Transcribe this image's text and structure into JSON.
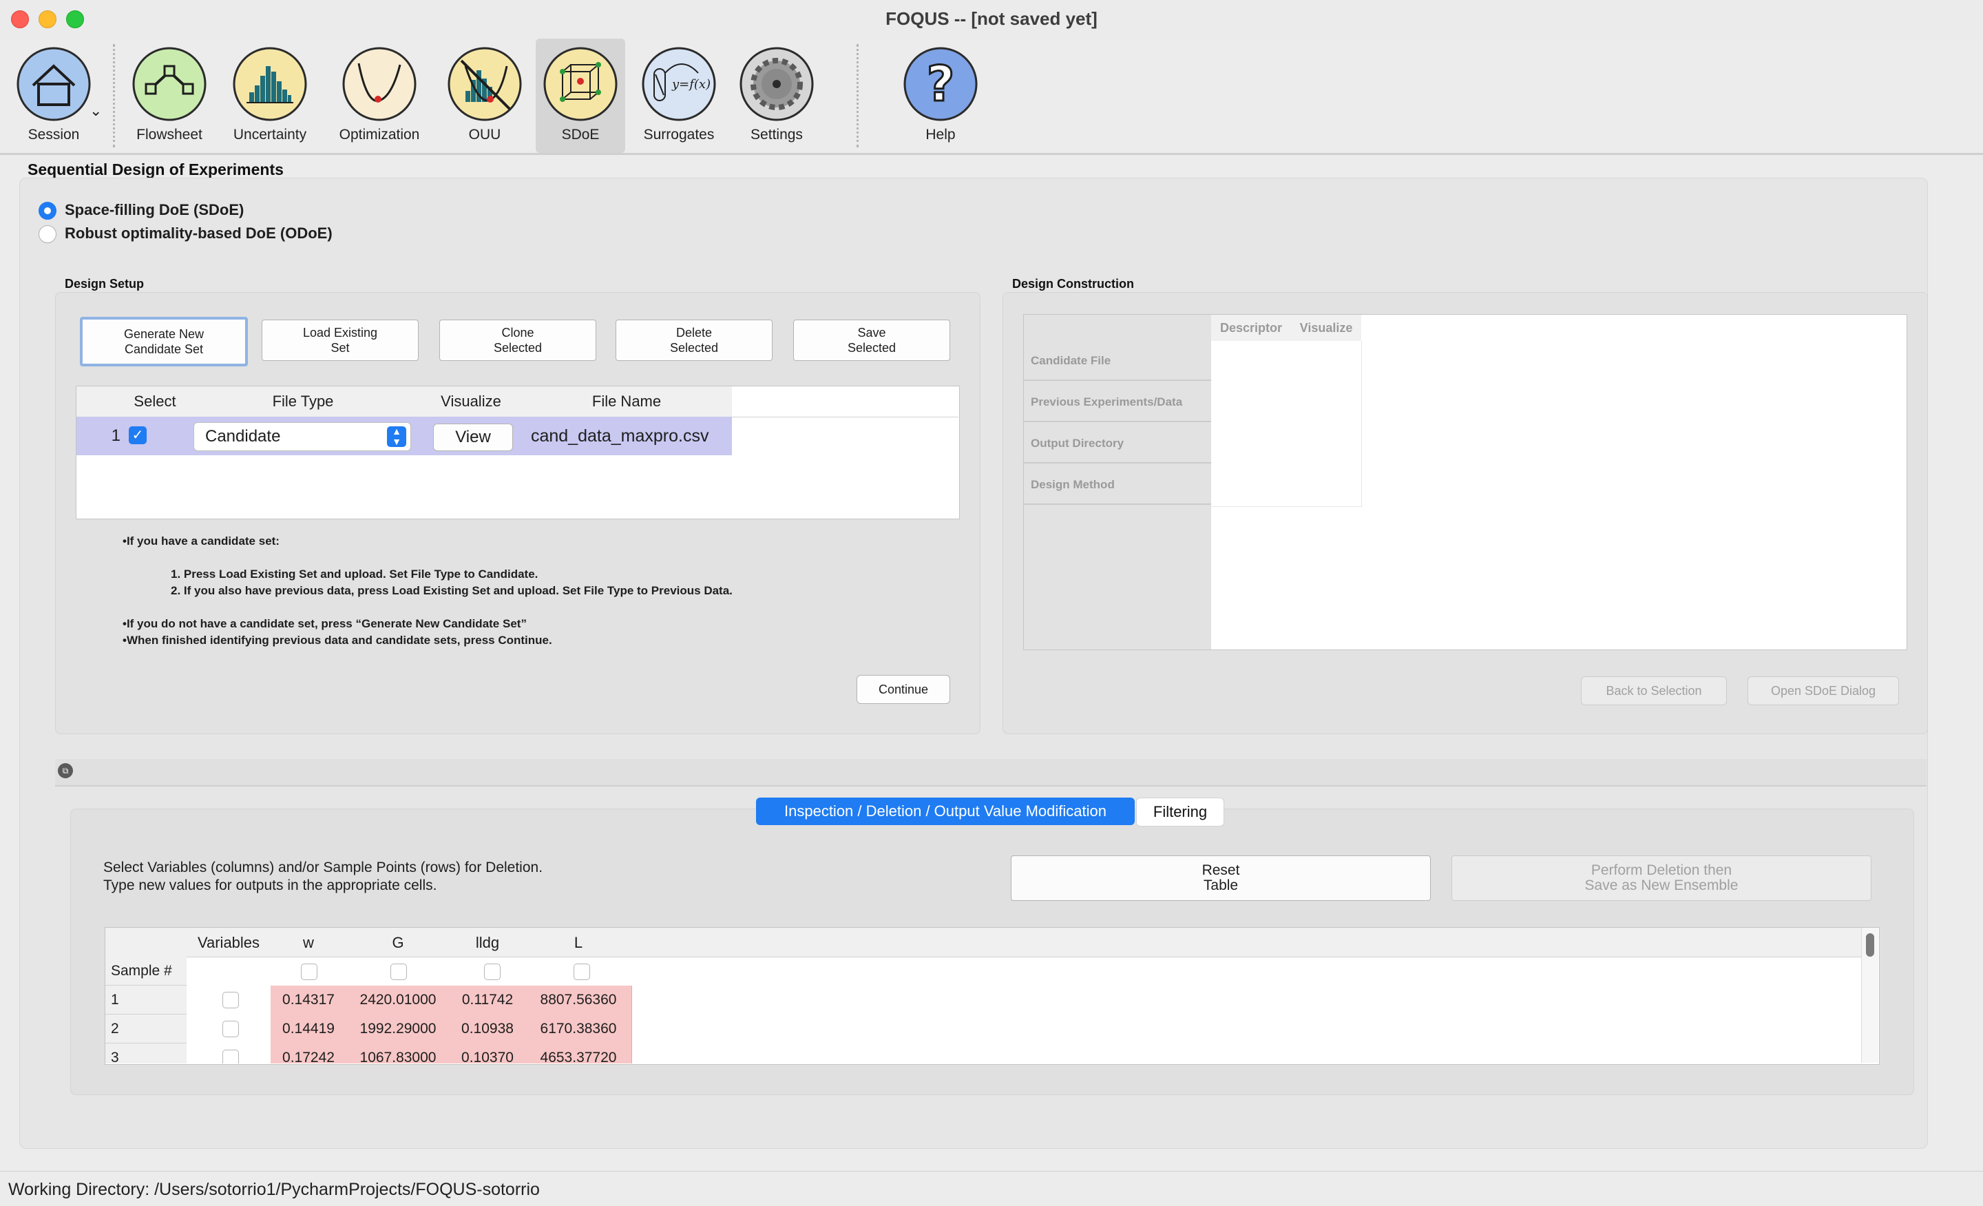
{
  "window": {
    "title": "FOQUS -- [not saved yet]"
  },
  "toolbar": {
    "items": [
      {
        "label": "Session",
        "icon": "home-icon"
      },
      {
        "label": "Flowsheet",
        "icon": "flowsheet-icon"
      },
      {
        "label": "Uncertainty",
        "icon": "histogram-icon"
      },
      {
        "label": "Optimization",
        "icon": "optimization-curve-icon"
      },
      {
        "label": "OUU",
        "icon": "ouu-icon"
      },
      {
        "label": "SDoE",
        "icon": "sdoe-cube-icon",
        "active": true
      },
      {
        "label": "Surrogates",
        "icon": "surrogate-function-icon"
      },
      {
        "label": "Settings",
        "icon": "gear-icon"
      },
      {
        "label": "Help",
        "icon": "help-question-icon"
      }
    ]
  },
  "page": {
    "title": "Sequential Design of Experiments"
  },
  "doe_type": {
    "options": [
      {
        "label": "Space-filling DoE (SDoE)",
        "selected": true
      },
      {
        "label": "Robust optimality-based DoE (ODoE)",
        "selected": false
      }
    ]
  },
  "design_setup": {
    "title": "Design Setup",
    "buttons": {
      "generate": "Generate New\nCandidate Set",
      "load": "Load Existing\nSet",
      "clone": "Clone\nSelected",
      "delete": "Delete\nSelected",
      "save": "Save\nSelected"
    },
    "table": {
      "headers": [
        "Select",
        "File Type",
        "Visualize",
        "File Name"
      ],
      "rows": [
        {
          "index": "1",
          "selected": true,
          "file_type": "Candidate",
          "visualize": "View",
          "file_name": "cand_data_maxpro.csv"
        }
      ]
    },
    "instructions": {
      "bullet1": "•If you have a candidate set:",
      "step1": "1. Press Load Existing Set and upload. Set File Type to Candidate.",
      "step2": "2. If you also have previous data, press Load Existing Set and upload. Set File Type to Previous Data.",
      "bullet2": "•If you do not have a candidate set, press “Generate New Candidate Set”",
      "bullet3": "•When finished identifying previous data and candidate sets, press Continue."
    },
    "continue_label": "Continue"
  },
  "design_construction": {
    "title": "Design Construction",
    "columns": [
      "Descriptor",
      "Visualize"
    ],
    "rows": [
      "Candidate File",
      "Previous Experiments/Data",
      "Output Directory",
      "Design Method"
    ],
    "back_label": "Back to Selection",
    "open_label": "Open SDoE Dialog"
  },
  "tabs": {
    "inspection": "Inspection / Deletion / Output Value Modification",
    "filtering": "Filtering"
  },
  "inspection": {
    "line1": "Select Variables (columns) and/or Sample Points (rows) for Deletion.",
    "line2": "Type new values for outputs in the appropriate cells.",
    "reset_label": "Reset\nTable",
    "perform_label": "Perform Deletion then\nSave as New Ensemble",
    "table": {
      "variables_header": "Variables",
      "sample_header": "Sample #",
      "columns": [
        "w",
        "G",
        "lldg",
        "L"
      ],
      "rows": [
        {
          "n": "1",
          "values": [
            "0.14317",
            "2420.01000",
            "0.11742",
            "8807.56360"
          ]
        },
        {
          "n": "2",
          "values": [
            "0.14419",
            "1992.29000",
            "0.10938",
            "6170.38360"
          ]
        },
        {
          "n": "3",
          "values": [
            "0.17242",
            "1067.83000",
            "0.10370",
            "4653.37720"
          ]
        }
      ]
    }
  },
  "status": {
    "working_directory": "Working Directory: /Users/sotorrio1/PycharmProjects/FOQUS-sotorrio"
  },
  "colors": {
    "accent": "#1f7cf2",
    "selected_row": "#c8c8f0",
    "pink_cell": "#f7c6c6"
  }
}
